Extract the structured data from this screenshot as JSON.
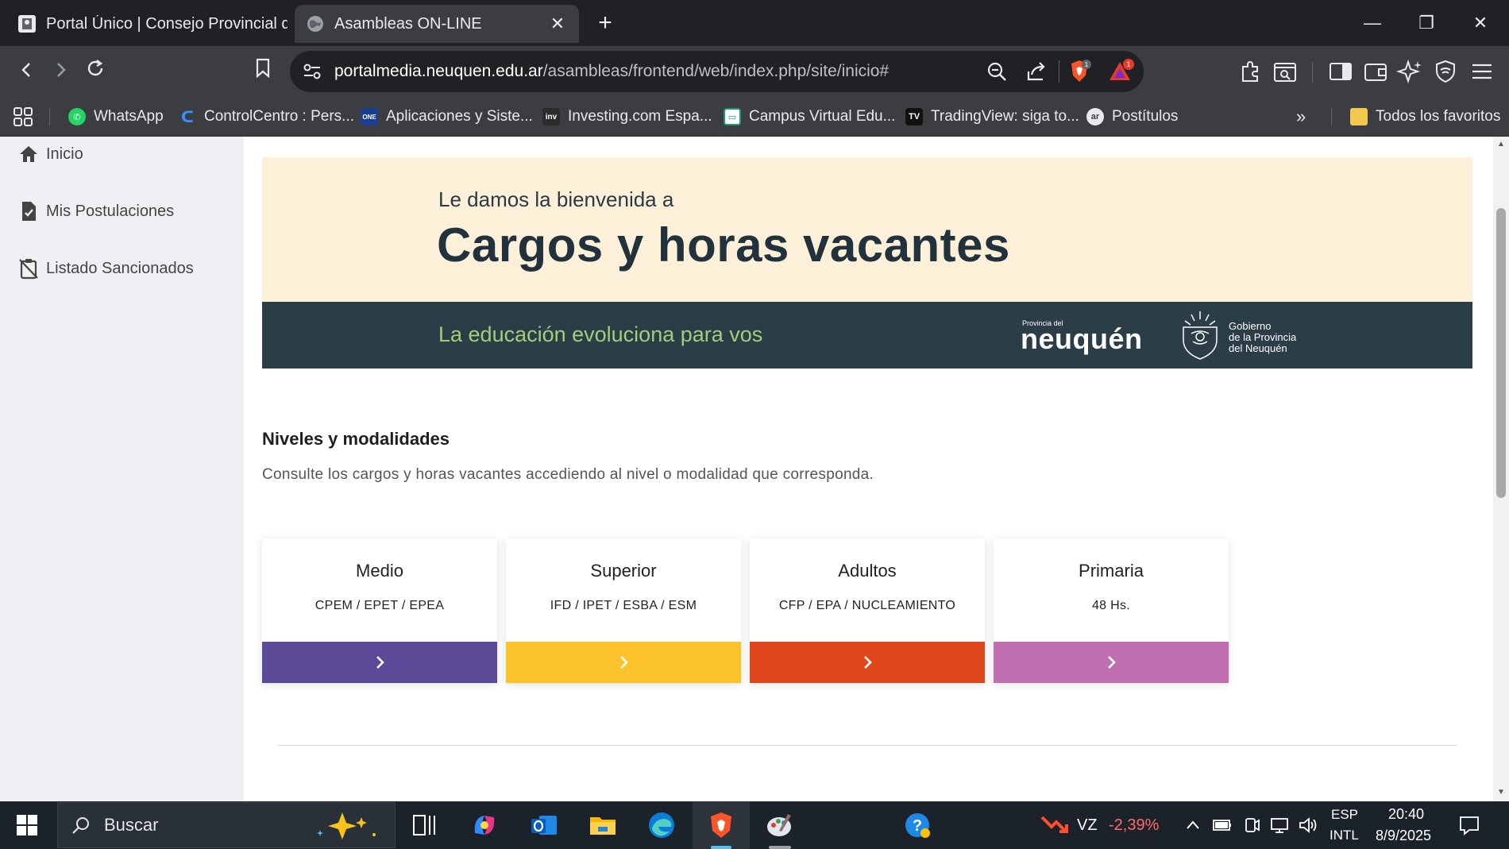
{
  "browser": {
    "tabs": [
      {
        "title": "Portal Único | Consejo Provincial de E",
        "active": false
      },
      {
        "title": "Asambleas ON-LINE",
        "active": true
      }
    ],
    "url_host": "portalmedia.neuquen.edu.ar",
    "url_path": "/asambleas/frontend/web/index.php/site/inicio#",
    "extension_badges": {
      "brave_shields": "1",
      "rewards": "1"
    },
    "bookmarks": [
      {
        "label": "WhatsApp",
        "icon": "whatsapp-icon"
      },
      {
        "label": "ControlCentro : Pers...",
        "icon": "controlcentro-icon"
      },
      {
        "label": "Aplicaciones y Siste...",
        "icon": "one-login-icon"
      },
      {
        "label": "Investing.com Espa...",
        "icon": "investing-icon"
      },
      {
        "label": "Campus Virtual Edu...",
        "icon": "campus-icon"
      },
      {
        "label": "TradingView: siga to...",
        "icon": "tradingview-icon"
      },
      {
        "label": "Postítulos",
        "icon": "postitulos-icon"
      }
    ],
    "bookmarks_folder": "Todos los favoritos"
  },
  "sidebar": {
    "items": [
      {
        "label": "Inicio",
        "icon": "home-icon"
      },
      {
        "label": "Mis Postulaciones",
        "icon": "document-check-icon"
      },
      {
        "label": "Listado Sancionados",
        "icon": "clipboard-off-icon"
      }
    ]
  },
  "hero": {
    "subtitle": "Le damos la bienvenida a",
    "title": "Cargos y horas vacantes",
    "slogan": "La educación evoluciona para vos",
    "brand_small": "Provincia del",
    "brand_name": "neuquén",
    "gob_line1": "Gobierno",
    "gob_line2": "de la Provincia",
    "gob_line3": "del Neuquén"
  },
  "niveles": {
    "title": "Niveles y modalidades",
    "description": "Consulte los cargos y horas vacantes accediendo al nivel o modalidad que corresponda.",
    "cards": [
      {
        "title": "Medio",
        "subtitle": "CPEM / EPET / EPEA",
        "color": "#5b4a98"
      },
      {
        "title": "Superior",
        "subtitle": "IFD / IPET / ESBA / ESM",
        "color": "#fcc22b"
      },
      {
        "title": "Adultos",
        "subtitle": "CFP / EPA / NUCLEAMIENTO",
        "color": "#e0461b"
      },
      {
        "title": "Primaria",
        "subtitle": "48 Hs.",
        "color": "#bf6fb0"
      }
    ]
  },
  "taskbar": {
    "search_label": "Buscar",
    "stock_ticker": "VZ",
    "stock_change": "-2,39%",
    "lang_top": "ESP",
    "lang_bottom": "INTL",
    "time": "20:40",
    "date": "8/9/2025"
  },
  "colors": {
    "hero_top_bg": "#fdf0d9",
    "hero_bottom_bg": "#2b3d47",
    "slogan": "#9fcf7a",
    "stock_negative": "#ff6b6b"
  }
}
